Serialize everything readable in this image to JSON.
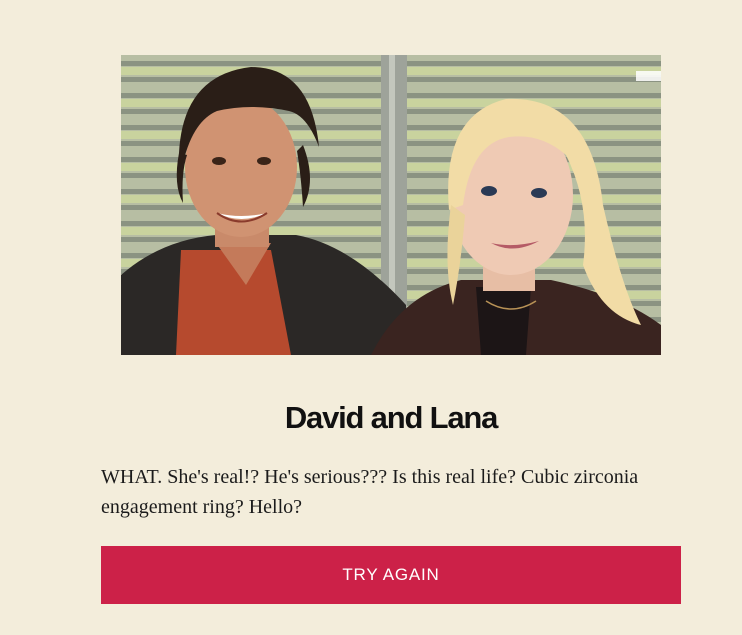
{
  "result": {
    "title": "David and Lana",
    "description": "WHAT. She's real!? He's serious??? Is this real life? Cubic zirconia engagement ring? Hello?",
    "button_label": "TRY AGAIN"
  },
  "colors": {
    "background": "#f3eddb",
    "button": "#cc2148",
    "button_text": "#ffffff"
  },
  "image": {
    "subject": "couple-portrait"
  }
}
